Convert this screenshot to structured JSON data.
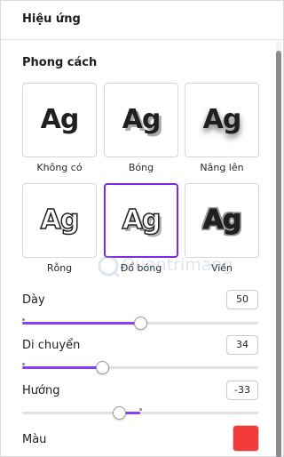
{
  "header": {
    "title": "Hiệu ứng"
  },
  "section": {
    "title": "Phong cách"
  },
  "tiles": [
    {
      "preview": "Ag",
      "label": "Không có",
      "selected": false
    },
    {
      "preview": "Ag",
      "label": "Bóng",
      "selected": false
    },
    {
      "preview": "Ag",
      "label": "Nâng lên",
      "selected": false
    },
    {
      "preview": "Ag",
      "label": "Rỗng",
      "selected": false
    },
    {
      "preview": "Ag",
      "label": "Đổ bóng",
      "selected": true
    },
    {
      "preview": "Ag",
      "label": "Viền",
      "selected": false
    }
  ],
  "sliders": [
    {
      "label": "Dày",
      "value": "50",
      "min": 0,
      "max": 100,
      "level": 50
    },
    {
      "label": "Di chuyển",
      "value": "34",
      "min": 0,
      "max": 100,
      "level": 34
    },
    {
      "label": "Hướng",
      "value": "-33",
      "min": -180,
      "max": 180,
      "level": -33
    }
  ],
  "color": {
    "label": "Màu",
    "value": "#f53a3a"
  },
  "watermark": {
    "text": "Quantrimang"
  },
  "colors": {
    "accent": "#8b3dff",
    "selected_border": "#7d2ae8"
  }
}
